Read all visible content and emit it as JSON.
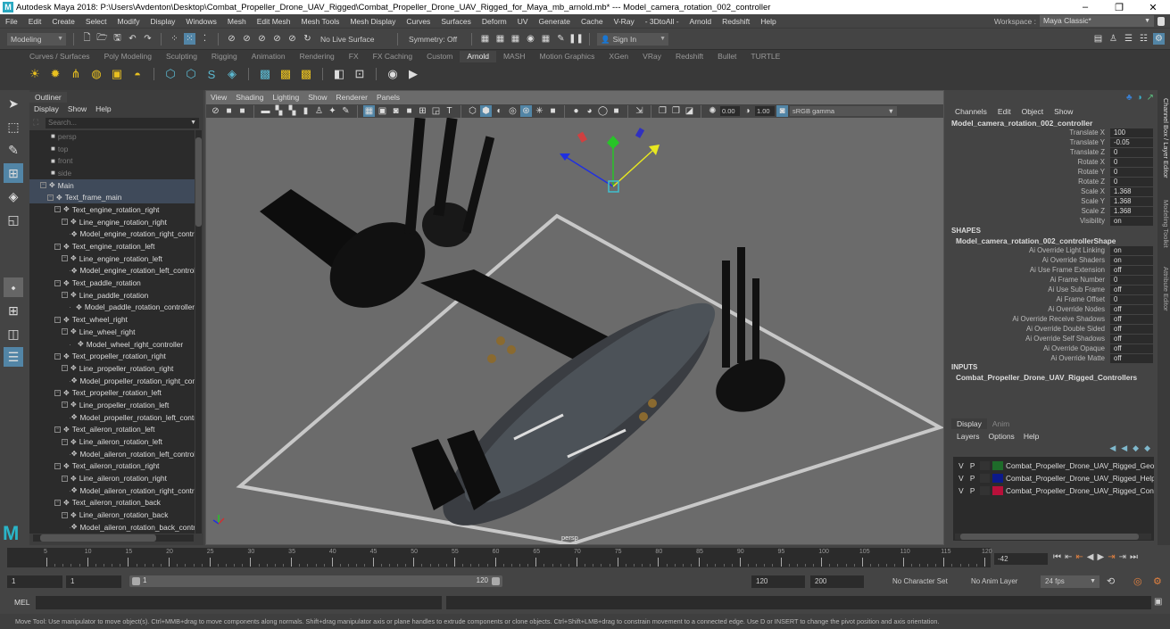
{
  "window": {
    "title": "Autodesk Maya 2018: P:\\Users\\Avdenton\\Desktop\\Combat_Propeller_Drone_UAV_Rigged\\Combat_Propeller_Drone_UAV_Rigged_for_Maya_mb_arnold.mb*   ---   Model_camera_rotation_002_controller",
    "logo": "M",
    "minimize": "–",
    "maximize": "❐",
    "close": "✕"
  },
  "menubar": [
    "File",
    "Edit",
    "Create",
    "Select",
    "Modify",
    "Display",
    "Windows",
    "Mesh",
    "Edit Mesh",
    "Mesh Tools",
    "Mesh Display",
    "Curves",
    "Surfaces",
    "Deform",
    "UV",
    "Generate",
    "Cache",
    "V-Ray",
    "- 3DtoAll -",
    "Arnold",
    "Redshift",
    "Help"
  ],
  "workspace": {
    "label": "Workspace :",
    "value": "Maya Classic*"
  },
  "statusline": {
    "mode": "Modeling",
    "live_surface": "No Live Surface",
    "symmetry": "Symmetry: Off",
    "sign_in": "Sign In"
  },
  "shelf": {
    "tabs": [
      "Curves / Surfaces",
      "Poly Modeling",
      "Sculpting",
      "Rigging",
      "Animation",
      "Rendering",
      "FX",
      "FX Caching",
      "Custom",
      "Arnold",
      "MASH",
      "Motion Graphics",
      "XGen",
      "VRay",
      "Redshift",
      "Bullet",
      "TURTLE"
    ],
    "active_tab": "Arnold"
  },
  "outliner": {
    "tab": "Outliner",
    "menu": [
      "Display",
      "Show",
      "Help"
    ],
    "search_placeholder": "Search...",
    "items": [
      {
        "label": "persp",
        "depth": 0,
        "type": "camera"
      },
      {
        "label": "top",
        "depth": 0,
        "type": "camera"
      },
      {
        "label": "front",
        "depth": 0,
        "type": "camera"
      },
      {
        "label": "side",
        "depth": 0,
        "type": "camera"
      },
      {
        "label": "Main",
        "depth": 0,
        "type": "node",
        "selected": true
      },
      {
        "label": "Text_frame_main",
        "depth": 1,
        "type": "node",
        "selected": true
      },
      {
        "label": "Text_engine_rotation_right",
        "depth": 2,
        "type": "node"
      },
      {
        "label": "Line_engine_rotation_right",
        "depth": 3,
        "type": "node"
      },
      {
        "label": "Model_engine_rotation_right_controller",
        "depth": 4,
        "type": "leaf"
      },
      {
        "label": "Text_engine_rotation_left",
        "depth": 2,
        "type": "node"
      },
      {
        "label": "Line_engine_rotation_left",
        "depth": 3,
        "type": "node"
      },
      {
        "label": "Model_engine_rotation_left_controller",
        "depth": 4,
        "type": "leaf"
      },
      {
        "label": "Text_paddle_rotation",
        "depth": 2,
        "type": "node"
      },
      {
        "label": "Line_paddle_rotation",
        "depth": 3,
        "type": "node"
      },
      {
        "label": "Model_paddle_rotation_controller",
        "depth": 4,
        "type": "leaf"
      },
      {
        "label": "Text_wheel_right",
        "depth": 2,
        "type": "node"
      },
      {
        "label": "Line_wheel_right",
        "depth": 3,
        "type": "node"
      },
      {
        "label": "Model_wheel_right_controller",
        "depth": 4,
        "type": "leaf"
      },
      {
        "label": "Text_propeller_rotation_right",
        "depth": 2,
        "type": "node"
      },
      {
        "label": "Line_propeller_rotation_right",
        "depth": 3,
        "type": "node"
      },
      {
        "label": "Model_propeller_rotation_right_controller",
        "depth": 4,
        "type": "leaf"
      },
      {
        "label": "Text_propeller_rotation_left",
        "depth": 2,
        "type": "node"
      },
      {
        "label": "Line_propeller_rotation_left",
        "depth": 3,
        "type": "node"
      },
      {
        "label": "Model_propeller_rotation_left_controller",
        "depth": 4,
        "type": "leaf"
      },
      {
        "label": "Text_aileron_rotation_left",
        "depth": 2,
        "type": "node"
      },
      {
        "label": "Line_aileron_rotation_left",
        "depth": 3,
        "type": "node"
      },
      {
        "label": "Model_aileron_rotation_left_controller",
        "depth": 4,
        "type": "leaf"
      },
      {
        "label": "Text_aileron_rotation_right",
        "depth": 2,
        "type": "node"
      },
      {
        "label": "Line_aileron_rotation_right",
        "depth": 3,
        "type": "node"
      },
      {
        "label": "Model_aileron_rotation_right_controller",
        "depth": 4,
        "type": "leaf"
      },
      {
        "label": "Text_aileron_rotation_back",
        "depth": 2,
        "type": "node"
      },
      {
        "label": "Line_aileron_rotation_back",
        "depth": 3,
        "type": "node"
      },
      {
        "label": "Model_aileron_rotation_back_controller",
        "depth": 4,
        "type": "leaf"
      }
    ]
  },
  "viewport": {
    "menu": [
      "View",
      "Shading",
      "Lighting",
      "Show",
      "Renderer",
      "Panels"
    ],
    "exposure": "0.00",
    "gamma": "1.00",
    "color_space": "sRGB gamma",
    "camera_label": "persp"
  },
  "channelbox": {
    "menu": [
      "Channels",
      "Edit",
      "Object",
      "Show"
    ],
    "object": "Model_camera_rotation_002_controller",
    "channels": [
      {
        "label": "Translate X",
        "value": "100"
      },
      {
        "label": "Translate Y",
        "value": "-0.05"
      },
      {
        "label": "Translate Z",
        "value": "0"
      },
      {
        "label": "Rotate X",
        "value": "0"
      },
      {
        "label": "Rotate Y",
        "value": "0"
      },
      {
        "label": "Rotate Z",
        "value": "0"
      },
      {
        "label": "Scale X",
        "value": "1.368"
      },
      {
        "label": "Scale Y",
        "value": "1.368"
      },
      {
        "label": "Scale Z",
        "value": "1.368"
      },
      {
        "label": "Visibility",
        "value": "on"
      }
    ],
    "shapes_header": "SHAPES",
    "shape_name": "Model_camera_rotation_002_controllerShape",
    "shape_attrs": [
      {
        "label": "Ai Override Light Linking",
        "value": "on"
      },
      {
        "label": "Ai Override Shaders",
        "value": "on"
      },
      {
        "label": "Ai Use Frame Extension",
        "value": "off"
      },
      {
        "label": "Ai Frame Number",
        "value": "0"
      },
      {
        "label": "Ai Use Sub Frame",
        "value": "off"
      },
      {
        "label": "Ai Frame Offset",
        "value": "0"
      },
      {
        "label": "Ai Override Nodes",
        "value": "off"
      },
      {
        "label": "Ai Override Receive Shadows",
        "value": "off"
      },
      {
        "label": "Ai Override Double Sided",
        "value": "off"
      },
      {
        "label": "Ai Override Self Shadows",
        "value": "off"
      },
      {
        "label": "Ai Override Opaque",
        "value": "off"
      },
      {
        "label": "Ai Override Matte",
        "value": "off"
      }
    ],
    "inputs_header": "INPUTS",
    "input_name": "Combat_Propeller_Drone_UAV_Rigged_Controllers"
  },
  "side_tabs": [
    "Channel Box / Layer Editor",
    "Modeling Toolkit",
    "Attribute Editor"
  ],
  "layer_editor": {
    "tabs": [
      "Display",
      "Anim"
    ],
    "active_tab": "Display",
    "menu": [
      "Layers",
      "Options",
      "Help"
    ],
    "layers": [
      {
        "v": "V",
        "p": "P",
        "color": "#1e6b2a",
        "name": "Combat_Propeller_Drone_UAV_Rigged_Geomtery"
      },
      {
        "v": "V",
        "p": "P",
        "color": "#0c1a8a",
        "name": "Combat_Propeller_Drone_UAV_Rigged_Helpers"
      },
      {
        "v": "V",
        "p": "P",
        "color": "#b8103a",
        "name": "Combat_Propeller_Drone_UAV_Rigged_Controllers"
      }
    ]
  },
  "timeline": {
    "ticks": [
      "5",
      "10",
      "15",
      "20",
      "25",
      "30",
      "35",
      "40",
      "45",
      "50",
      "55",
      "60",
      "65",
      "70",
      "75",
      "80",
      "85",
      "90",
      "95",
      "100",
      "105",
      "110",
      "115",
      "120"
    ],
    "current_frame": "-42",
    "start": "1",
    "range_start": "1",
    "slider_start": "1",
    "slider_end": "120",
    "range_end": "120",
    "end": "200",
    "character_set": "No Character Set",
    "anim_layer": "No Anim Layer",
    "fps": "24 fps"
  },
  "cmdline": {
    "label": "MEL"
  },
  "helpline": "Move Tool: Use manipulator to move object(s). Ctrl+MMB+drag to move components along normals. Shift+drag manipulator axis or plane handles to extrude components or clone objects. Ctrl+Shift+LMB+drag to constrain movement to a connected edge. Use D or INSERT to change the pivot position and axis orientation."
}
